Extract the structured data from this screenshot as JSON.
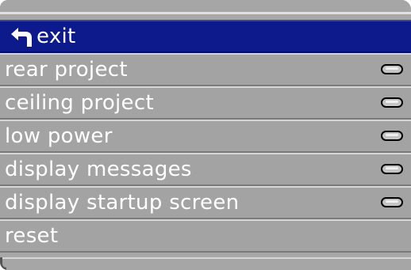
{
  "menu": {
    "exit": {
      "label": "exit",
      "icon": "back-arrow-icon"
    },
    "items": [
      {
        "label": "rear project",
        "toggle_state": "off"
      },
      {
        "label": "ceiling project",
        "toggle_state": "off"
      },
      {
        "label": "low power",
        "toggle_state": "off"
      },
      {
        "label": "display messages",
        "toggle_state": "off"
      },
      {
        "label": "display startup screen",
        "toggle_state": "off"
      },
      {
        "label": "reset"
      }
    ]
  },
  "colors": {
    "highlight": "#0c1a8c",
    "row_bg": "#a3a3a3",
    "text": "#ffffff"
  }
}
